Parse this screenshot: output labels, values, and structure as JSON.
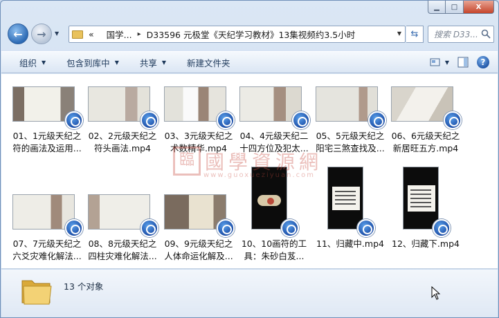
{
  "window": {
    "caption_minimize": "▁",
    "caption_maximize": "□",
    "caption_close": "X"
  },
  "address": {
    "chevron": "«",
    "crumbs": [
      "国学...",
      "D33596 元极堂《天纪学习教材》13集视频约3.5小时"
    ],
    "separator": "▸"
  },
  "search": {
    "placeholder": "搜索 D33..."
  },
  "toolbar": {
    "organize": "组织",
    "include_library": "包含到库中",
    "share": "共享",
    "new_folder": "新建文件夹",
    "help": "?"
  },
  "files": [
    {
      "line1": "01、1元级天纪之",
      "line2": "符的画法及运用..."
    },
    {
      "line1": "02、2元级天纪之",
      "line2": "符头画法.mp4"
    },
    {
      "line1": "03、3元级天纪之",
      "line2": "术数精华.mp4"
    },
    {
      "line1": "04、4元级天纪二",
      "line2": "十四方位及犯太..."
    },
    {
      "line1": "05、5元级天纪之",
      "line2": "阳宅三煞查找及..."
    },
    {
      "line1": "06、6元级天纪之",
      "line2": "新居旺五方.mp4"
    },
    {
      "line1": "07、7元级天纪之",
      "line2": "六爻灾难化解法..."
    },
    {
      "line1": "08、8元级天纪之",
      "line2": "四柱灾难化解法..."
    },
    {
      "line1": "09、9元级天纪之",
      "line2": "人体命运化解及..."
    },
    {
      "line1": "10、10画符的工",
      "line2": "具：朱砂白芨..."
    },
    {
      "line1": "11、归藏中.mp4",
      "line2": ""
    },
    {
      "line1": "12、归藏下.mp4",
      "line2": ""
    }
  ],
  "watermark": {
    "seal": "臨",
    "text": "國學資源網",
    "url": "www.guoxueziyuan.com"
  },
  "status": {
    "count": "13 个对象"
  },
  "colors": {
    "accent": "#1e395b",
    "badge": "#1d4fa8"
  }
}
